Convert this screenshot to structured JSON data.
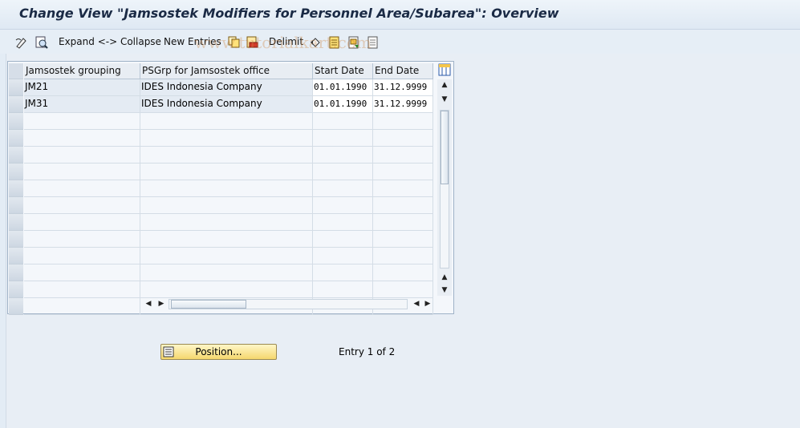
{
  "window": {
    "title": "Change View \"Jamsostek Modifiers for Personnel Area/Subarea\": Overview"
  },
  "toolbar": {
    "items": [
      {
        "name": "edit-toggle-icon"
      },
      {
        "name": "detail-view-icon"
      },
      {
        "label": "Expand <-> Collapse"
      },
      {
        "label": "New Entries"
      },
      {
        "name": "copy-icon"
      },
      {
        "name": "delete-icon"
      },
      {
        "label": "Delimit"
      },
      {
        "name": "undo-icon"
      },
      {
        "name": "select-all-icon"
      },
      {
        "name": "select-block-icon"
      },
      {
        "name": "deselect-all-icon"
      }
    ],
    "watermark": "www.tutorialkart.com"
  },
  "table": {
    "columns": [
      "Jamsostek grouping",
      "PSGrp for Jamsostek office",
      "Start Date",
      "End Date"
    ],
    "rows": [
      [
        "JM21",
        "IDES Indonesia Company",
        "01.01.1990",
        "31.12.9999"
      ],
      [
        "JM31",
        "IDES Indonesia Company",
        "01.01.1990",
        "31.12.9999"
      ]
    ],
    "empty_row_count": 12
  },
  "footer": {
    "position_label": "Position...",
    "entry_info": "Entry 1 of 2"
  }
}
